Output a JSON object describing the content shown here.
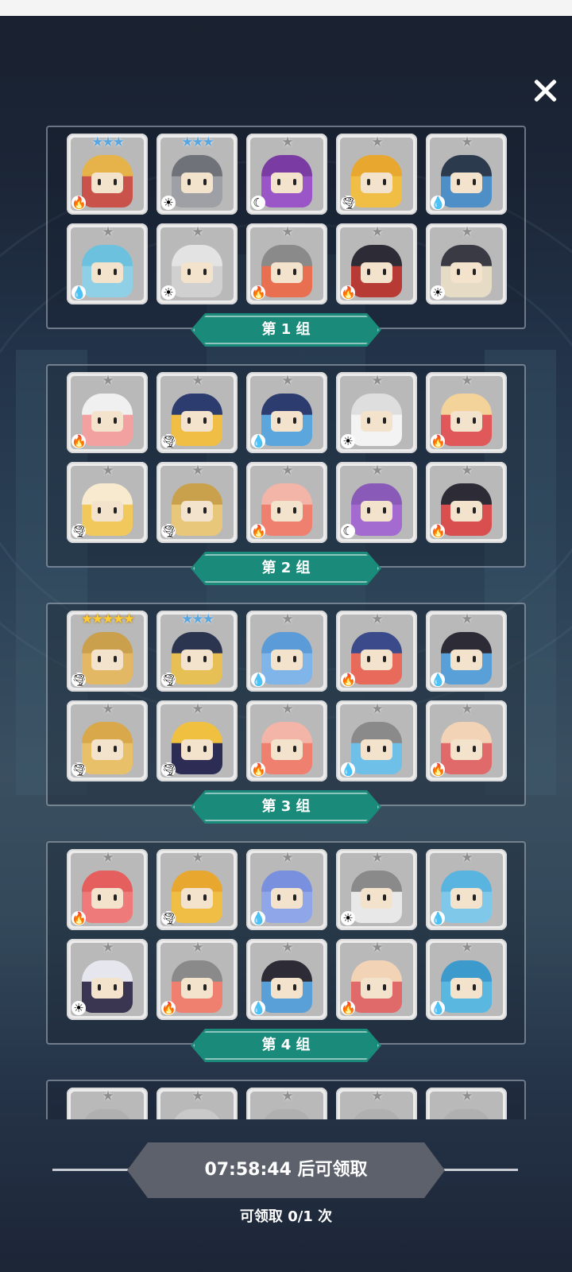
{
  "close_label": "✕",
  "claim": {
    "button_label": "07:58:44 后可领取",
    "count_label": "可领取 0/1 次"
  },
  "groups": [
    {
      "label": "第 1 组",
      "cards": [
        {
          "name": "card-1-1",
          "stars": "★★★",
          "star_color": "blue",
          "element": "fire",
          "color": "#c9534a",
          "hair": "#e6b24a"
        },
        {
          "name": "card-1-2",
          "stars": "★★★",
          "star_color": "blue",
          "element": "light",
          "color": "#9ea0a5",
          "hair": "#6f7278"
        },
        {
          "name": "card-1-3",
          "stars": "★",
          "star_color": "gray",
          "element": "dark",
          "color": "#9a55c7",
          "hair": "#7a3ba3"
        },
        {
          "name": "card-1-4",
          "stars": "★",
          "star_color": "gray",
          "element": "wind",
          "color": "#f0be45",
          "hair": "#e8a82f"
        },
        {
          "name": "card-1-5",
          "stars": "★",
          "star_color": "gray",
          "element": "water",
          "color": "#4f8fc7",
          "hair": "#2c3a4e"
        },
        {
          "name": "card-1-6",
          "stars": "★",
          "star_color": "gray",
          "element": "water",
          "color": "#8fd0e6",
          "hair": "#6cc2de"
        },
        {
          "name": "card-1-7",
          "stars": "★",
          "star_color": "gray",
          "element": "light",
          "color": "#d0d0d0",
          "hair": "#e3e3e3"
        },
        {
          "name": "card-1-8",
          "stars": "★",
          "star_color": "gray",
          "element": "fire",
          "color": "#e86f4f",
          "hair": "#8a8a8a"
        },
        {
          "name": "card-1-9",
          "stars": "★",
          "star_color": "gray",
          "element": "fire",
          "color": "#b83a35",
          "hair": "#2d2b35"
        },
        {
          "name": "card-1-10",
          "stars": "★",
          "star_color": "gray",
          "element": "light",
          "color": "#e6dcc6",
          "hair": "#3a3a44"
        }
      ]
    },
    {
      "label": "第 2 组",
      "cards": [
        {
          "name": "card-2-1",
          "stars": "★",
          "star_color": "gray",
          "element": "fire",
          "color": "#f2a0a0",
          "hair": "#f0f0f0"
        },
        {
          "name": "card-2-2",
          "stars": "★",
          "star_color": "gray",
          "element": "wind",
          "color": "#f0be45",
          "hair": "#2c3c6e"
        },
        {
          "name": "card-2-3",
          "stars": "★",
          "star_color": "gray",
          "element": "water",
          "color": "#5aa6dd",
          "hair": "#2c3c6e"
        },
        {
          "name": "card-2-4",
          "stars": "★",
          "star_color": "gray",
          "element": "light",
          "color": "#f3f3f3",
          "hair": "#dedede"
        },
        {
          "name": "card-2-5",
          "stars": "★",
          "star_color": "gray",
          "element": "fire",
          "color": "#e0585a",
          "hair": "#f3d39a"
        },
        {
          "name": "card-2-6",
          "stars": "★",
          "star_color": "gray",
          "element": "wind",
          "color": "#f1c85c",
          "hair": "#f7eacf"
        },
        {
          "name": "card-2-7",
          "stars": "★",
          "star_color": "gray",
          "element": "wind",
          "color": "#e9c77a",
          "hair": "#c9a14c"
        },
        {
          "name": "card-2-8",
          "stars": "★",
          "star_color": "gray",
          "element": "fire",
          "color": "#ef7f6e",
          "hair": "#f2b5a7"
        },
        {
          "name": "card-2-9",
          "stars": "★",
          "star_color": "gray",
          "element": "dark",
          "color": "#a36ad0",
          "hair": "#8a5ab8"
        },
        {
          "name": "card-2-10",
          "stars": "★",
          "star_color": "gray",
          "element": "fire",
          "color": "#d94f4f",
          "hair": "#2d2b35"
        }
      ]
    },
    {
      "label": "第 3 组",
      "cards": [
        {
          "name": "card-3-1",
          "stars": "★★★★★",
          "star_color": "gold",
          "element": "wind",
          "color": "#e3b865",
          "hair": "#caa04c"
        },
        {
          "name": "card-3-2",
          "stars": "★★★",
          "star_color": "blue",
          "element": "wind",
          "color": "#e6bf55",
          "hair": "#2c3550"
        },
        {
          "name": "card-3-3",
          "stars": "★",
          "star_color": "gray",
          "element": "water",
          "color": "#7fb5e8",
          "hair": "#5b9bd8"
        },
        {
          "name": "card-3-4",
          "stars": "★",
          "star_color": "gray",
          "element": "fire",
          "color": "#e86a5a",
          "hair": "#3b4a8a"
        },
        {
          "name": "card-3-5",
          "stars": "★",
          "star_color": "gray",
          "element": "water",
          "color": "#5aa0d8",
          "hair": "#2d2b35"
        },
        {
          "name": "card-3-6",
          "stars": "★",
          "star_color": "gray",
          "element": "wind",
          "color": "#e9c06a",
          "hair": "#d8a84a"
        },
        {
          "name": "card-3-7",
          "stars": "★",
          "star_color": "gray",
          "element": "wind",
          "color": "#2c2c55",
          "hair": "#f0c040"
        },
        {
          "name": "card-3-8",
          "stars": "★",
          "star_color": "gray",
          "element": "fire",
          "color": "#ef7f6e",
          "hair": "#f2b5a7"
        },
        {
          "name": "card-3-9",
          "stars": "★",
          "star_color": "gray",
          "element": "water",
          "color": "#6fc0e8",
          "hair": "#8a8a8a"
        },
        {
          "name": "card-3-10",
          "stars": "★",
          "star_color": "gray",
          "element": "fire",
          "color": "#e06a6a",
          "hair": "#f3d3b5"
        }
      ]
    },
    {
      "label": "第 4 组",
      "cards": [
        {
          "name": "card-4-1",
          "stars": "★",
          "star_color": "gray",
          "element": "fire",
          "color": "#ef7a7a",
          "hair": "#e55f5f"
        },
        {
          "name": "card-4-2",
          "stars": "★",
          "star_color": "gray",
          "element": "wind",
          "color": "#f0be45",
          "hair": "#e8a82f"
        },
        {
          "name": "card-4-3",
          "stars": "★",
          "star_color": "gray",
          "element": "water",
          "color": "#8fa6e8",
          "hair": "#7890dd"
        },
        {
          "name": "card-4-4",
          "stars": "★",
          "star_color": "gray",
          "element": "light",
          "color": "#e8e8e8",
          "hair": "#8a8a8a"
        },
        {
          "name": "card-4-5",
          "stars": "★",
          "star_color": "gray",
          "element": "water",
          "color": "#7fc8ea",
          "hair": "#5ab4e0"
        },
        {
          "name": "card-4-6",
          "stars": "★",
          "star_color": "gray",
          "element": "light",
          "color": "#3a3550",
          "hair": "#e6e6ee"
        },
        {
          "name": "card-4-7",
          "stars": "★",
          "star_color": "gray",
          "element": "fire",
          "color": "#ef7f6e",
          "hair": "#8a8a8a"
        },
        {
          "name": "card-4-8",
          "stars": "★",
          "star_color": "gray",
          "element": "water",
          "color": "#5aa0d8",
          "hair": "#2d2b35"
        },
        {
          "name": "card-4-9",
          "stars": "★",
          "star_color": "gray",
          "element": "fire",
          "color": "#e06a6a",
          "hair": "#f3d3b5"
        },
        {
          "name": "card-4-10",
          "stars": "★",
          "star_color": "gray",
          "element": "water",
          "color": "#5ab8e0",
          "hair": "#3d9acc"
        }
      ]
    },
    {
      "label": "",
      "cards": [
        {
          "name": "card-5-1",
          "stars": "★",
          "star_color": "gray",
          "element": "",
          "color": "#c9c9c9",
          "hair": "#b0b0b0"
        },
        {
          "name": "card-5-2",
          "stars": "★",
          "star_color": "gray",
          "element": "",
          "color": "#e58c80",
          "hair": "#c9c9c9"
        },
        {
          "name": "card-5-3",
          "stars": "★",
          "star_color": "gray",
          "element": "",
          "color": "#c9c9c9",
          "hair": "#b0b0b0"
        },
        {
          "name": "card-5-4",
          "stars": "★",
          "star_color": "gray",
          "element": "",
          "color": "#c9c9c9",
          "hair": "#b0b0b0"
        },
        {
          "name": "card-5-5",
          "stars": "★",
          "star_color": "gray",
          "element": "",
          "color": "#c9c9c9",
          "hair": "#b0b0b0"
        }
      ]
    }
  ],
  "element_icons": {
    "fire": "🔥",
    "water": "💧",
    "wind": "🌪",
    "light": "☀",
    "dark": "☾"
  },
  "colors": {
    "banner": "#1a8a7a",
    "claim_button": "#5c616b"
  }
}
